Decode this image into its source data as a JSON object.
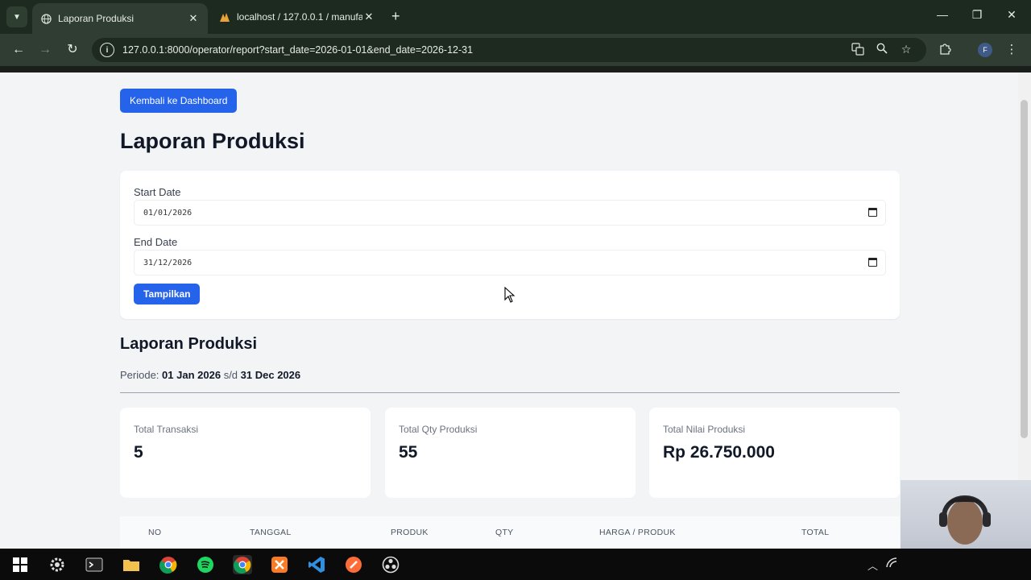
{
  "browser": {
    "tabs": [
      {
        "title": "Laporan Produksi",
        "favicon": "globe-icon",
        "active": true
      },
      {
        "title": "localhost / 127.0.0.1 / manufact",
        "favicon": "phpmyadmin-icon",
        "active": false
      }
    ],
    "url": "127.0.0.1:8000/operator/report?start_date=2026-01-01&end_date=2026-12-31",
    "profile_initial": "F"
  },
  "page": {
    "back_button": "Kembali ke Dashboard",
    "title": "Laporan Produksi",
    "filter": {
      "start_label": "Start Date",
      "start_value": "01/01/2026",
      "end_label": "End Date",
      "end_value": "31/12/2026",
      "submit_label": "Tampilkan"
    },
    "report": {
      "title": "Laporan Produksi",
      "periode_label": "Periode:",
      "periode_start": "01 Jan 2026",
      "periode_sep": "s/d",
      "periode_end": "31 Dec 2026"
    },
    "stats": [
      {
        "label": "Total Transaksi",
        "value": "5"
      },
      {
        "label": "Total Qty Produksi",
        "value": "55"
      },
      {
        "label": "Total Nilai Produksi",
        "value": "Rp 26.750.000"
      }
    ],
    "table": {
      "columns": [
        "NO",
        "TANGGAL",
        "PRODUK",
        "QTY",
        "HARGA / PRODUK",
        "TOTAL"
      ]
    }
  },
  "colors": {
    "primary": "#2563eb",
    "page_bg": "#f3f4f6",
    "chrome_bg": "#2f3d32"
  }
}
